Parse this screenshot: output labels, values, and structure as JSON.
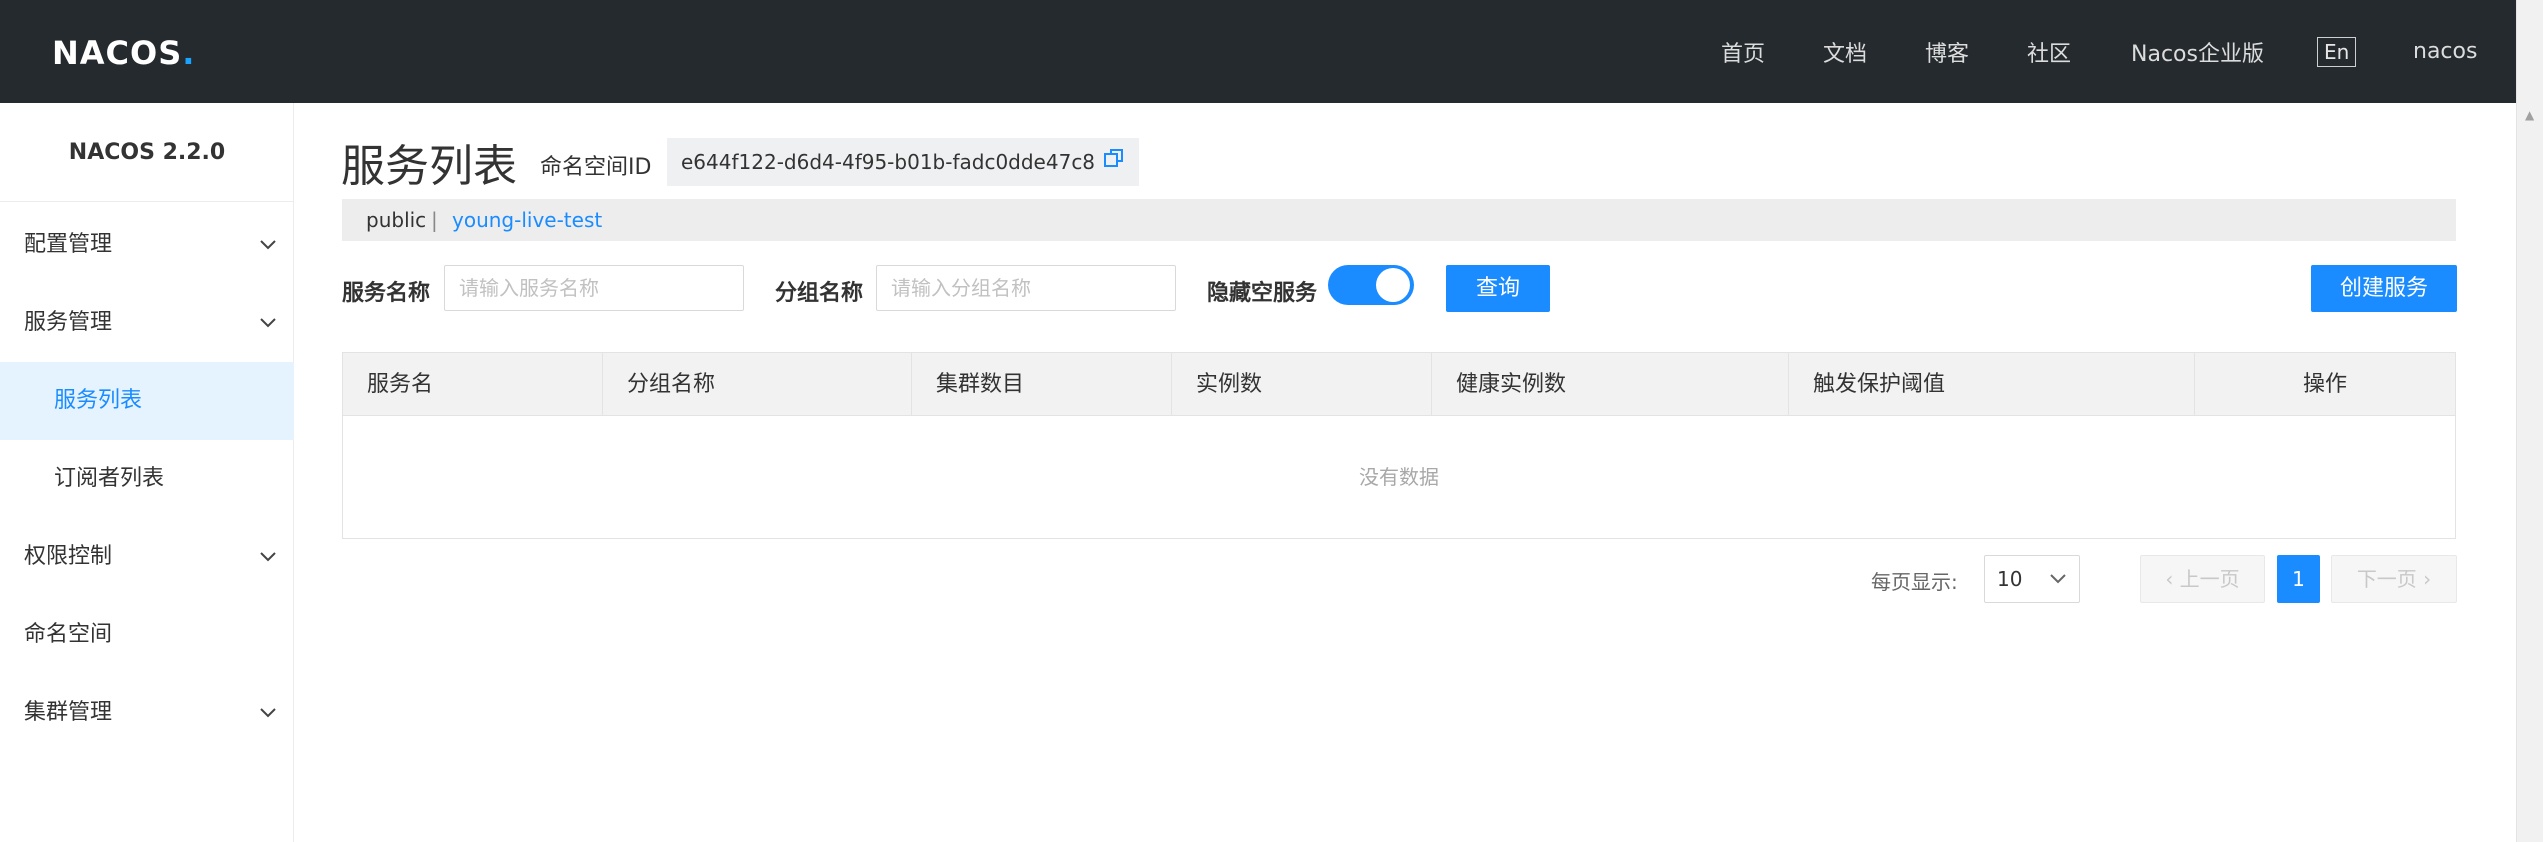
{
  "header": {
    "logo": "NACOS",
    "logo_dot": ".",
    "nav": [
      "首页",
      "文档",
      "博客",
      "社区",
      "Nacos企业版"
    ],
    "lang": "En",
    "user": "nacos"
  },
  "sidebar": {
    "version": "NACOS 2.2.0",
    "items": [
      {
        "label": "配置管理",
        "expandable": true
      },
      {
        "label": "服务管理",
        "expandable": true
      },
      {
        "label": "服务列表",
        "active": true
      },
      {
        "label": "订阅者列表"
      },
      {
        "label": "权限控制",
        "expandable": true
      },
      {
        "label": "命名空间"
      },
      {
        "label": "集群管理",
        "expandable": true
      }
    ]
  },
  "page": {
    "title": "服务列表",
    "namespace_label": "命名空间ID",
    "namespace_id": "e644f122-d6d4-4f95-b01b-fadc0dde47c8"
  },
  "namespaces": {
    "public": "public",
    "separator": "|",
    "current": "young-live-test"
  },
  "filters": {
    "service_name_label": "服务名称",
    "service_name_placeholder": "请输入服务名称",
    "group_name_label": "分组名称",
    "group_name_placeholder": "请输入分组名称",
    "hide_empty_label": "隐藏空服务",
    "hide_empty_on": true,
    "query_button": "查询",
    "create_button": "创建服务"
  },
  "table": {
    "columns": [
      "服务名",
      "分组名称",
      "集群数目",
      "实例数",
      "健康实例数",
      "触发保护阈值",
      "操作"
    ],
    "empty_text": "没有数据"
  },
  "pagination": {
    "page_size_label": "每页显示:",
    "page_size": "10",
    "prev": "上一页",
    "current": "1",
    "next": "下一页"
  },
  "colors": {
    "topbar": "#252a2f",
    "accent": "#1a8cff",
    "active_bg": "#e5f3ff"
  }
}
